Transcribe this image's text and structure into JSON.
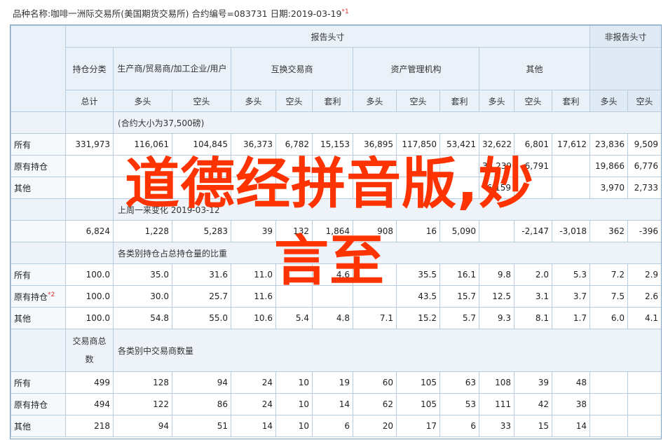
{
  "header_line": {
    "text": "品种名称:咖啡一洲际交易所(美国期货交易所)  合约编号=083731  日期:2019-03-19",
    "sup": "*1"
  },
  "groups": {
    "report": "报告头寸",
    "nonreport": "非报告头寸",
    "position_class": "持仓分类",
    "producer": "生产商/贸易商/加工企业/用户",
    "swap": "互换交易商",
    "manager": "资产管理机构",
    "other": "其他"
  },
  "cols": {
    "total": "总计",
    "long": "多头",
    "short": "空头",
    "spread": "套利"
  },
  "sections": {
    "contract_size": "(合约大小为37,500磅)",
    "change": "上周一来变化 2019-03-12",
    "ratio": "各类别持仓占总持仓量的比重",
    "trader_total": "交易商总数",
    "trader_count": "各类别中交易商数量"
  },
  "rows_positions": [
    {
      "label": "所有",
      "v": [
        "331,973",
        "116,061",
        "104,845",
        "36,373",
        "6,782",
        "15,153",
        "36,895",
        "117,850",
        "53,421",
        "32,622",
        "6,801",
        "17,612",
        "23,836",
        "9,509"
      ]
    },
    {
      "label": "原有持仓",
      "v": [
        "",
        "",
        "",
        "",
        "",
        "",
        "",
        "",
        "",
        "33,239",
        "6,791",
        "",
        "19,866",
        "6,776"
      ]
    },
    {
      "label": "其他",
      "v": [
        "",
        "",
        "",
        "",
        "",
        "",
        "",
        "",
        "",
        "6,159",
        "",
        "",
        "3,970",
        "2,733"
      ]
    }
  ],
  "row_change": [
    "6,824",
    "1,228",
    "5,283",
    "39",
    "132",
    "1,864",
    "908",
    "16",
    "5,090",
    "",
    "-2,147",
    "-3,018",
    "362",
    "-396"
  ],
  "rows_ratio": [
    {
      "label": "所有",
      "v": [
        "100.0",
        "35.0",
        "31.6",
        "11.0",
        "",
        "4.6",
        "",
        "35.5",
        "16.1",
        "9.8",
        "2.0",
        "5.3",
        "7.2",
        "2.9"
      ]
    },
    {
      "label": "原有持仓",
      "sup": "*2",
      "v": [
        "100.0",
        "30.0",
        "25.7",
        "11.6",
        "",
        "",
        "",
        "43.5",
        "15.7",
        "12.5",
        "3.1",
        "3.7",
        "7.5",
        "2.6"
      ]
    },
    {
      "label": "其他",
      "v": [
        "100.0",
        "54.8",
        "55.0",
        "10.6",
        "5.4",
        "4.8",
        "7.1",
        "15.2",
        "5.7",
        "9.3",
        "8.1",
        "1.7",
        "6.0",
        "4.1"
      ]
    }
  ],
  "rows_traders": [
    {
      "label": "所有",
      "v": [
        "499",
        "128",
        "94",
        "24",
        "10",
        "19",
        "60",
        "105",
        "63",
        "108",
        "39",
        "48"
      ]
    },
    {
      "label": "原有持仓",
      "v": [
        "494",
        "122",
        "86",
        "24",
        "10",
        "14",
        "62",
        "105",
        "53",
        "111",
        "42",
        "38"
      ]
    },
    {
      "label": "其他",
      "v": [
        "218",
        "94",
        "51",
        "14",
        "10",
        "6",
        "20",
        "17",
        "6",
        "33",
        "15",
        "14"
      ]
    }
  ],
  "overlay": {
    "line1": "道德经拼音版,妙",
    "line2": "言至",
    "color": "#ff3300"
  }
}
